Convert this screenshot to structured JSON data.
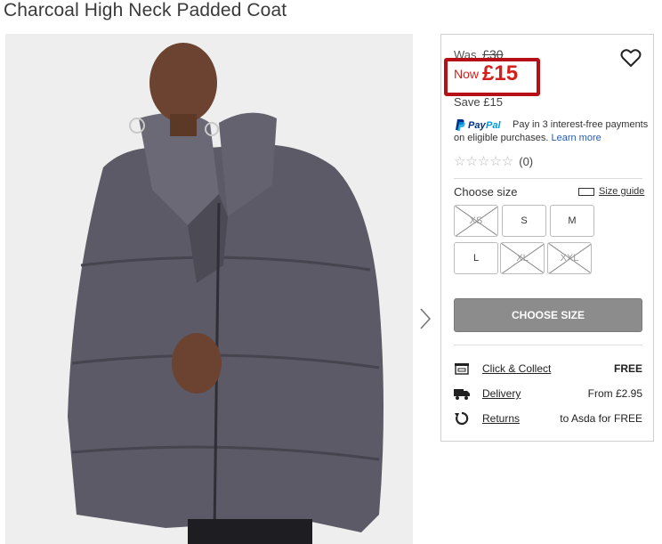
{
  "product": {
    "title": "Charcoal High Neck Padded Coat",
    "image_alt": "Model wearing charcoal high neck padded coat"
  },
  "pricing": {
    "was_label": "Was",
    "was_price": "£30",
    "now_label": "Now",
    "now_price": "£15",
    "save_text": "Save £15"
  },
  "paypal": {
    "brand": "PayPal",
    "message": "Pay in 3 interest-free payments on eligible purchases.",
    "learn_more": "Learn more"
  },
  "rating": {
    "stars": "☆☆☆☆☆",
    "count": "(0)"
  },
  "sizes": {
    "label": "Choose size",
    "guide_label": "Size guide",
    "options": [
      {
        "label": "XS",
        "available": false
      },
      {
        "label": "S",
        "available": true
      },
      {
        "label": "M",
        "available": true
      },
      {
        "label": "L",
        "available": true
      },
      {
        "label": "XL",
        "available": false
      },
      {
        "label": "XXL",
        "available": false
      }
    ]
  },
  "cta": {
    "choose_size": "CHOOSE SIZE"
  },
  "fulfilment": [
    {
      "icon": "store-icon",
      "label": "Click & Collect",
      "value": "FREE"
    },
    {
      "icon": "truck-icon",
      "label": "Delivery",
      "value": "From £2.95"
    },
    {
      "icon": "returns-icon",
      "label": "Returns",
      "value": "to Asda for FREE"
    }
  ],
  "colors": {
    "price_red": "#d3201b",
    "highlight_border": "#b70f16",
    "cta_grey": "#8c8c8c",
    "paypal_blue": "#2a5ba8"
  }
}
